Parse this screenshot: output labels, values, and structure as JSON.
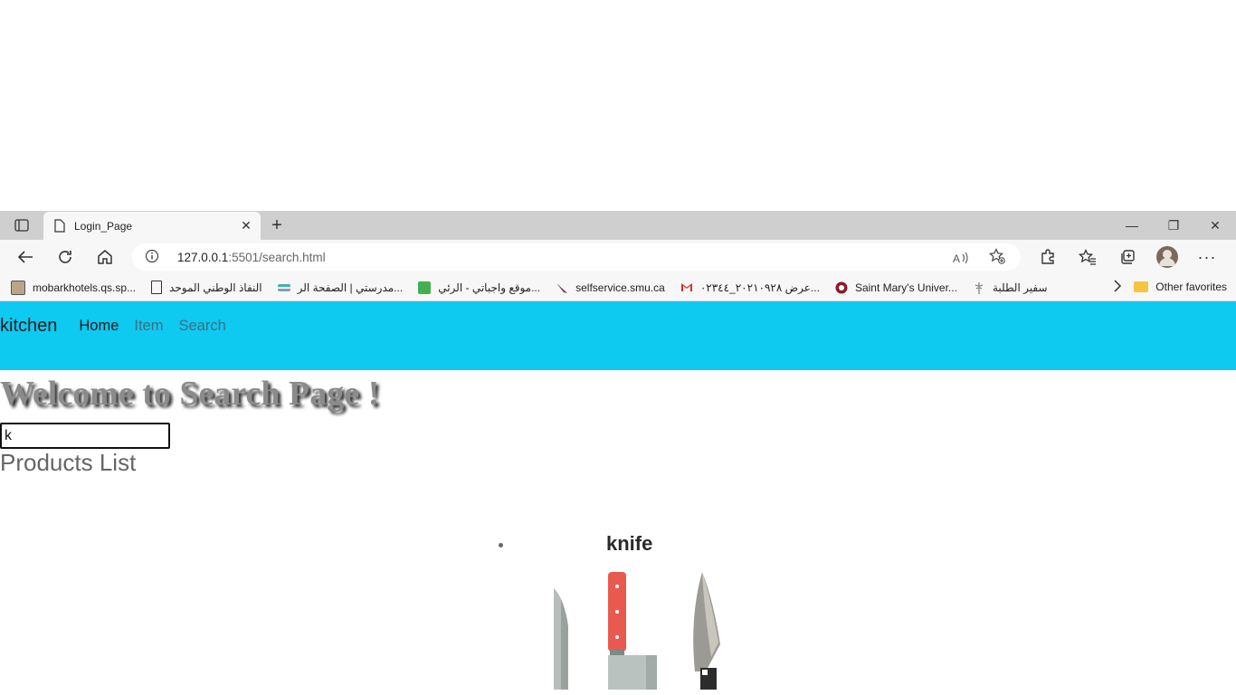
{
  "browser": {
    "tab_title": "Login_Page",
    "new_tab_symbol": "+",
    "window_controls": {
      "minimize": "—",
      "restore": "❐",
      "close": "✕"
    },
    "address": {
      "host": "127.0.0.1",
      "port_path": ":5501/search.html"
    },
    "bookmarks": [
      {
        "label": "mobarkhotels.qs.sp...",
        "icon": "hotel-icon"
      },
      {
        "label": "النفاذ الوطني الموحد",
        "icon": "page-icon"
      },
      {
        "label": "مدرستي | الصفحة الر...",
        "icon": "school-icon"
      },
      {
        "label": "موقع واجباتي - الرئي...",
        "icon": "briefcase-icon"
      },
      {
        "label": "selfservice.smu.ca",
        "icon": "feather-icon"
      },
      {
        "label": "عرض ٢٠٢١٠٩٢٨_٠٢٣٤٤...",
        "icon": "gmail-icon"
      },
      {
        "label": "Saint Mary's Univer...",
        "icon": "crest-icon"
      },
      {
        "label": "سفير الطلبة",
        "icon": "caduceus-icon"
      }
    ],
    "other_favorites": "Other favorites",
    "colors": {
      "tabstrip": "#cfcfcf",
      "toolbar": "#f7f7f7"
    }
  },
  "page": {
    "navbar": {
      "brand": "kitchen",
      "links": [
        {
          "label": "Home",
          "active": true
        },
        {
          "label": "Item",
          "active": false
        },
        {
          "label": "Search",
          "active": false
        }
      ],
      "color": "#0ec9f0"
    },
    "heading": "Welcome to Search Page !",
    "search": {
      "value": "k",
      "placeholder": ""
    },
    "products_heading": "Products List",
    "products": [
      {
        "name": "knife",
        "image": "knives-illustration"
      }
    ]
  }
}
